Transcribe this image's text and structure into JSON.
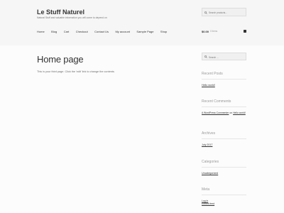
{
  "site": {
    "title": "Le Stuff Naturel",
    "tagline": "Natural Stuff and valuable information you will come to depend on"
  },
  "header_search": {
    "placeholder": "Search products…"
  },
  "nav": {
    "items": [
      "Home",
      "Blog",
      "Cart",
      "Checkout",
      "Contact Us",
      "My account",
      "Sample Page",
      "Shop"
    ]
  },
  "cart": {
    "amount": "$0.00",
    "items": "0 items"
  },
  "main": {
    "title": "Home page",
    "content": "This is your third page. Click the 'edit' link to change the contents"
  },
  "sidebar": {
    "search_placeholder": "Search …",
    "recent_posts": {
      "title": "Recent Posts",
      "items": [
        "Hello world!"
      ]
    },
    "recent_comments": {
      "title": "Recent Comments",
      "author": "A WordPress Commenter",
      "on": "on",
      "post": "Hello world!"
    },
    "archives": {
      "title": "Archives",
      "items": [
        "July 2017"
      ]
    },
    "categories": {
      "title": "Categories",
      "items": [
        "Uncategorized"
      ]
    },
    "meta": {
      "title": "Meta",
      "items": [
        "Log in",
        "Entries feed"
      ]
    }
  }
}
